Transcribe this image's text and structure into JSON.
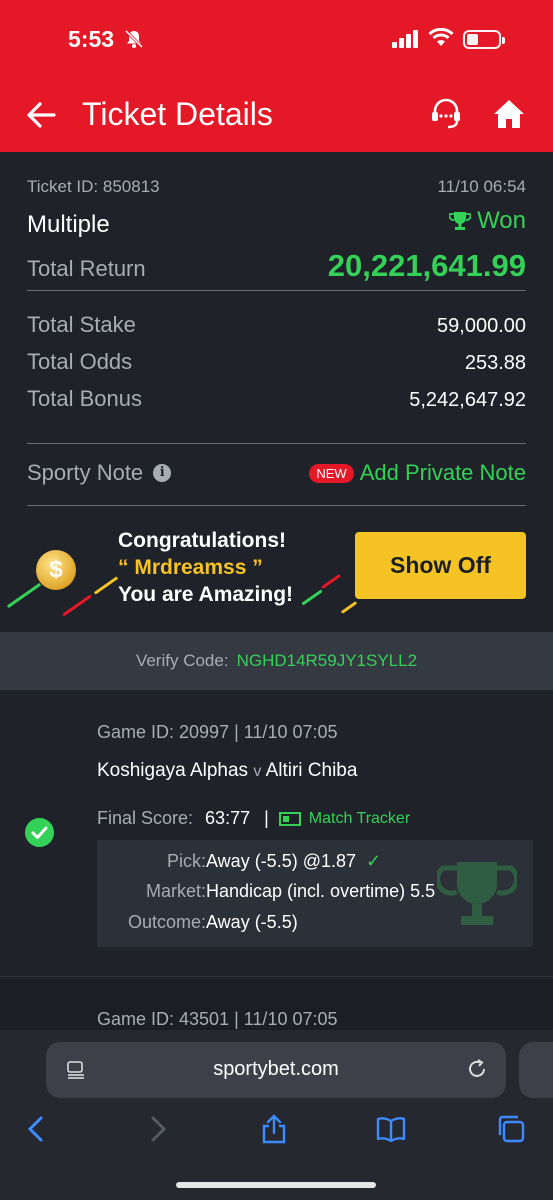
{
  "status_bar": {
    "time": "5:53"
  },
  "header": {
    "title": "Ticket Details"
  },
  "ticket": {
    "id_label": "Ticket ID: 850813",
    "datetime": "11/10 06:54",
    "type": "Multiple",
    "status": "Won",
    "total_return_label": "Total Return",
    "total_return": "20,221,641.99",
    "total_stake_label": "Total Stake",
    "total_stake": "59,000.00",
    "total_odds_label": "Total Odds",
    "total_odds": "253.88",
    "total_bonus_label": "Total Bonus",
    "total_bonus": "5,242,647.92",
    "sporty_note_label": "Sporty Note",
    "new_badge": "NEW",
    "add_note_label": "Add Private Note"
  },
  "congrats": {
    "line1": "Congratulations!",
    "line2": "“ Mrdreamss ”",
    "line3": "You are Amazing!",
    "button": "Show Off"
  },
  "verify": {
    "label": "Verify Code:",
    "code": "NGHD14R59JY1SYLL2"
  },
  "game": {
    "id_line": "Game ID: 20997 | 11/10 07:05",
    "home": "Koshigaya Alphas",
    "vs": "v",
    "away": "Altiri Chiba",
    "final_score_label": "Final Score:",
    "final_score": "63:77",
    "tracker_label": "Match Tracker",
    "pick_label": "Pick:",
    "pick_value": "Away (-5.5) @1.87",
    "market_label": "Market:",
    "market_value": "Handicap (incl. overtime) 5.5",
    "outcome_label": "Outcome:",
    "outcome_value": "Away (-5.5)"
  },
  "game2": {
    "id_line": "Game ID: 43501 | 11/10 07:05"
  },
  "browser": {
    "url": "sportybet.com"
  },
  "colors": {
    "header_red": "#e41827",
    "win_green": "#34d158",
    "button_yellow": "#f6c325",
    "background": "#1f2228"
  }
}
